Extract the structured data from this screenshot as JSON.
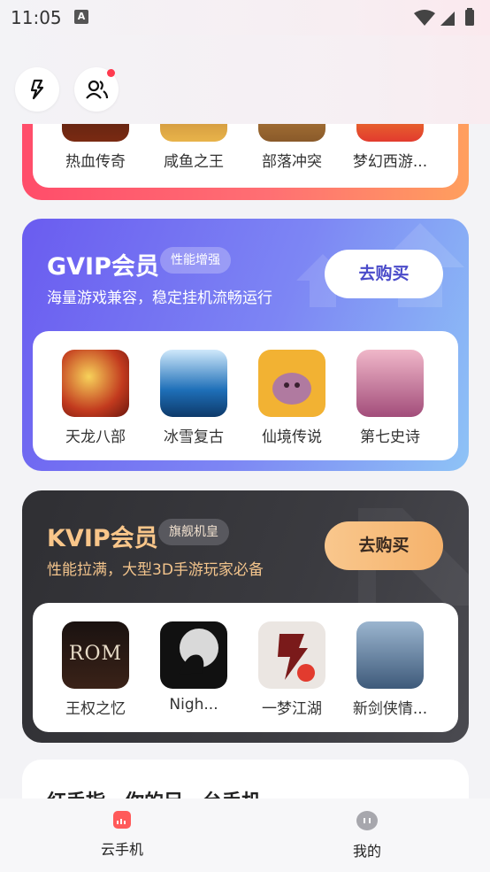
{
  "status_bar": {
    "time": "11:05",
    "notification_icon": "A"
  },
  "header": {
    "icons": [
      "lightning-icon",
      "friends-icon"
    ]
  },
  "top_card": {
    "games": [
      {
        "name": "热血传奇",
        "icon": "game-rexue-icon",
        "color": "#7a2a12"
      },
      {
        "name": "咸鱼之王",
        "icon": "game-xianyu-icon",
        "color": "#e8b34a"
      },
      {
        "name": "部落冲突",
        "icon": "game-buluo-icon",
        "color": "#c07a3a"
      },
      {
        "name": "梦幻西游...",
        "icon": "game-menghuan-icon",
        "color": "#e23b2e"
      }
    ]
  },
  "gvip": {
    "title": "GVIP会员",
    "badge": "性能增强",
    "description": "海量游戏兼容，稳定挂机流畅运行",
    "buy_label": "去购买",
    "games": [
      {
        "name": "天龙八部",
        "icon": "game-tianlong-icon",
        "color": "#b3261e"
      },
      {
        "name": "冰雪复古",
        "icon": "game-bingxue-icon",
        "color": "#1e6fb8"
      },
      {
        "name": "仙境传说",
        "icon": "game-xianjing-icon",
        "color": "#f2b233"
      },
      {
        "name": "第七史诗",
        "icon": "game-diqi-icon",
        "color": "#c79aa8"
      }
    ]
  },
  "kvip": {
    "title": "KVIP会员",
    "badge": "旗舰机皇",
    "description": "性能拉满，大型3D手游玩家必备",
    "buy_label": "去购买",
    "games": [
      {
        "name": "王权之忆",
        "icon": "game-rom-icon",
        "color": "#2a1a16",
        "logo": "ROM"
      },
      {
        "name": "Nigh...",
        "icon": "game-night-icon",
        "color": "#1a1a1a"
      },
      {
        "name": "一梦江湖",
        "icon": "game-yimeng-icon",
        "color": "#e9e4df"
      },
      {
        "name": "新剑侠情...",
        "icon": "game-xinjianxia-icon",
        "color": "#5b7fa6"
      }
    ]
  },
  "bottom_card": {
    "text": "红手指，你的另一台手机"
  },
  "nav": {
    "items": [
      {
        "label": "云手机",
        "icon": "cloud-phone-icon",
        "active": true
      },
      {
        "label": "我的",
        "icon": "profile-icon",
        "active": false
      }
    ]
  },
  "colors": {
    "gvip_gradient": [
      "#6a5cf0",
      "#8ec3f6"
    ],
    "kvip_bg": "#2f2f33",
    "kvip_accent": "#f9c68a",
    "top_card_gradient": [
      "#ff4d6a",
      "#ff9f5e"
    ]
  }
}
